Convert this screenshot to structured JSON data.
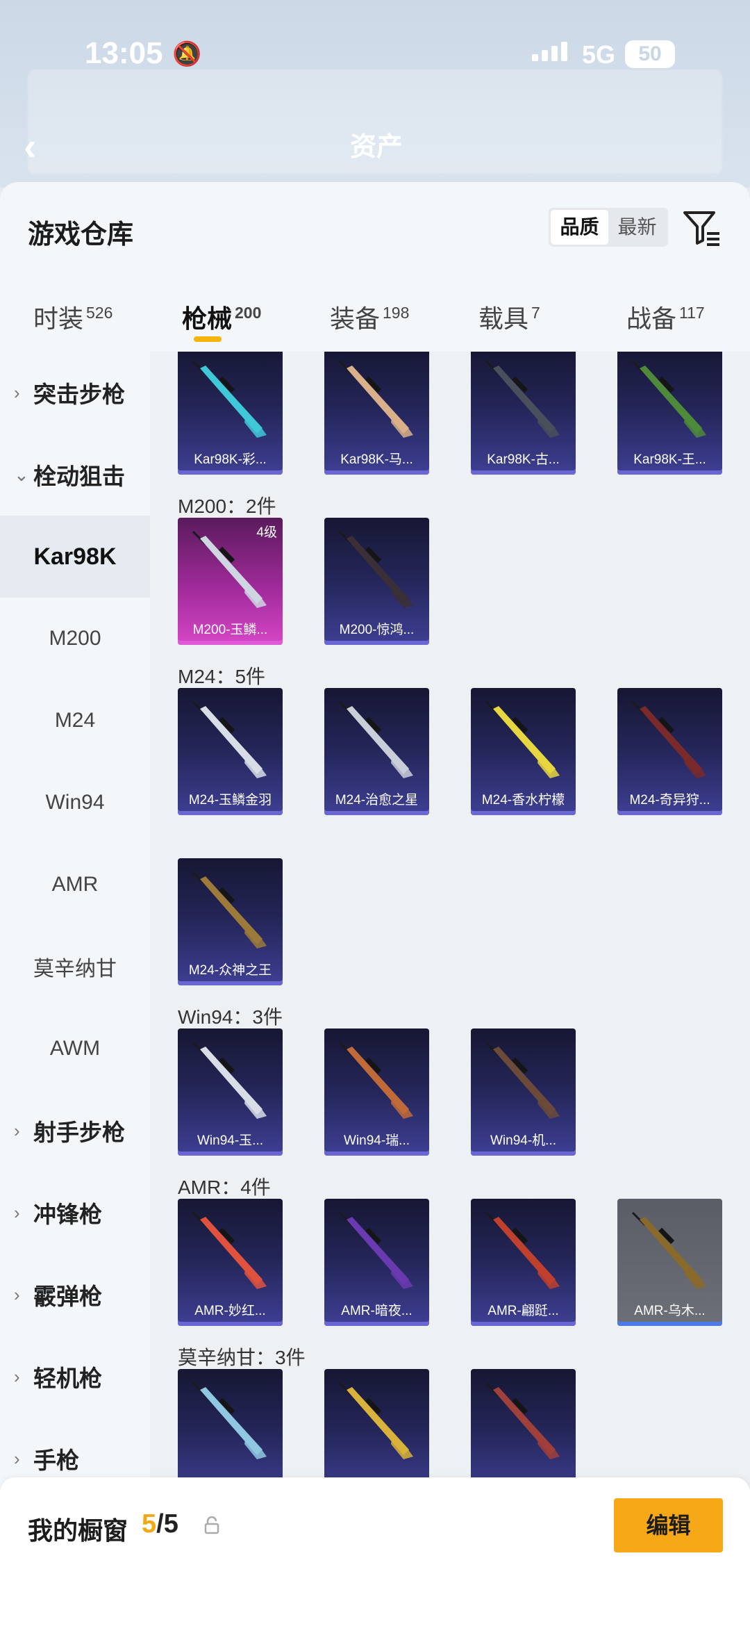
{
  "status_bar": {
    "time": "13:05",
    "network": "5G",
    "battery": "50"
  },
  "header": {
    "assets_label": "资产"
  },
  "warehouse": {
    "title": "游戏仓库",
    "sort_options": [
      "品质",
      "最新"
    ],
    "tabs": [
      {
        "label": "时装",
        "count": "526"
      },
      {
        "label": "枪械",
        "count": "200"
      },
      {
        "label": "装备",
        "count": "198"
      },
      {
        "label": "载具",
        "count": "7"
      },
      {
        "label": "战备",
        "count": "117"
      }
    ]
  },
  "sidebar": {
    "items": [
      {
        "label": "突击步枪",
        "type": "category"
      },
      {
        "label": "栓动狙击",
        "type": "category",
        "expanded": true
      },
      {
        "label": "Kar98K",
        "type": "sub",
        "selected": true
      },
      {
        "label": "M200",
        "type": "sub"
      },
      {
        "label": "M24",
        "type": "sub"
      },
      {
        "label": "Win94",
        "type": "sub"
      },
      {
        "label": "AMR",
        "type": "sub"
      },
      {
        "label": "莫辛纳甘",
        "type": "sub"
      },
      {
        "label": "AWM",
        "type": "sub"
      },
      {
        "label": "射手步枪",
        "type": "category"
      },
      {
        "label": "冲锋枪",
        "type": "category"
      },
      {
        "label": "霰弹枪",
        "type": "category"
      },
      {
        "label": "轻机枪",
        "type": "category"
      },
      {
        "label": "手枪",
        "type": "category"
      }
    ]
  },
  "sections": [
    {
      "title": "",
      "items": [
        {
          "name": "Kar98K-彩...",
          "tone": "#3fc8d8"
        },
        {
          "name": "Kar98K-马...",
          "tone": "#d9b08a"
        },
        {
          "name": "Kar98K-古...",
          "tone": "#4a4f5c"
        },
        {
          "name": "Kar98K-王...",
          "tone": "#4e8a3a"
        }
      ]
    },
    {
      "title": "M200：2件",
      "items": [
        {
          "name": "M200-玉鳞...",
          "level": "4级",
          "rarity": "pink",
          "tone": "#cfd6e2"
        },
        {
          "name": "M200-惊鸿...",
          "tone": "#3a2f36"
        }
      ]
    },
    {
      "title": "M24：5件",
      "items": [
        {
          "name": "M24-玉鳞金羽",
          "tone": "#d8dde6"
        },
        {
          "name": "M24-治愈之星",
          "tone": "#c9ced8"
        },
        {
          "name": "M24-香水柠檬",
          "tone": "#e8d640"
        },
        {
          "name": "M24-奇异狩...",
          "tone": "#7a2a2a"
        },
        {
          "name": "M24-众神之王",
          "tone": "#9c7a3a"
        }
      ]
    },
    {
      "title": "Win94：3件",
      "items": [
        {
          "name": "Win94-玉...",
          "tone": "#d8dde6"
        },
        {
          "name": "Win94-瑞...",
          "tone": "#c06a3a"
        },
        {
          "name": "Win94-机...",
          "tone": "#6b4a3a"
        }
      ]
    },
    {
      "title": "AMR：4件",
      "items": [
        {
          "name": "AMR-妙红...",
          "tone": "#e0523e"
        },
        {
          "name": "AMR-暗夜...",
          "tone": "#6a3ab0"
        },
        {
          "name": "AMR-翩跹...",
          "tone": "#c0402e"
        },
        {
          "name": "AMR-乌木...",
          "rarity": "gray",
          "tone": "#8a6a2a"
        }
      ]
    },
    {
      "title": "莫辛纳甘：3件",
      "items": [
        {
          "name": "",
          "tone": "#8fc8e0"
        },
        {
          "name": "",
          "tone": "#d8b23a"
        },
        {
          "name": "",
          "tone": "#a0403a"
        }
      ]
    }
  ],
  "showcase": {
    "label": "我的橱窗",
    "current": "5",
    "total": "/5",
    "edit_label": "编辑"
  }
}
